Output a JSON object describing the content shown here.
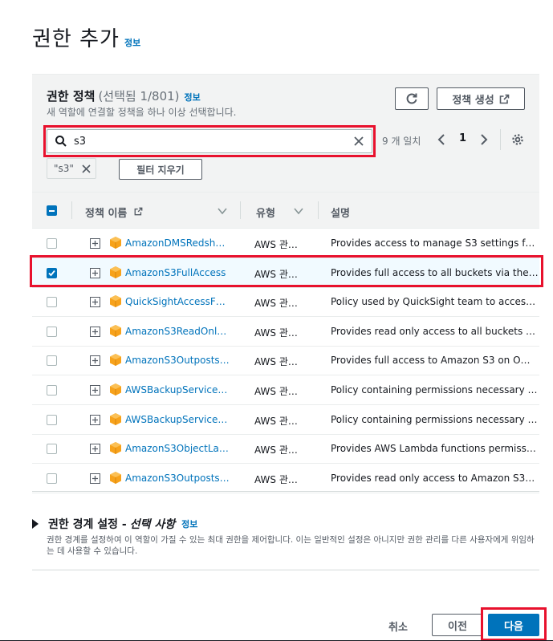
{
  "page": {
    "title": "권한 추가",
    "info_link": "정보"
  },
  "policies": {
    "title": "권한 정책",
    "count": "(선택됨 1/801)",
    "info_link": "정보",
    "description": "새 역할에 연결할 정책을 하나 이상 선택합니다.",
    "create_label": "정책 생성",
    "search_value": "s3",
    "match_text": "9 개 일치",
    "page": "1",
    "filter_token": "\"s3\"",
    "clear_filters_label": "필터 지우기",
    "columns": {
      "name": "정책 이름",
      "type": "유형",
      "description": "설명"
    },
    "rows": [
      {
        "name": "AmazonDMSRedsh…",
        "type": "AWS 관…",
        "description": "Provides access to manage S3 settings f…",
        "checked": false
      },
      {
        "name": "AmazonS3FullAccess",
        "type": "AWS 관…",
        "description": "Provides full access to all buckets via the…",
        "checked": true
      },
      {
        "name": "QuickSightAccessF…",
        "type": "AWS 관…",
        "description": "Policy used by QuickSight team to acces…",
        "checked": false
      },
      {
        "name": "AmazonS3ReadOnl…",
        "type": "AWS 관…",
        "description": "Provides read only access to all buckets …",
        "checked": false
      },
      {
        "name": "AmazonS3Outposts…",
        "type": "AWS 관…",
        "description": "Provides full access to Amazon S3 on O…",
        "checked": false
      },
      {
        "name": "AWSBackupService…",
        "type": "AWS 관…",
        "description": "Policy containing permissions necessary …",
        "checked": false
      },
      {
        "name": "AWSBackupService…",
        "type": "AWS 관…",
        "description": "Policy containing permissions necessary …",
        "checked": false
      },
      {
        "name": "AmazonS3ObjectLa…",
        "type": "AWS 관…",
        "description": "Provides AWS Lambda functions permiss…",
        "checked": false
      },
      {
        "name": "AmazonS3Outposts…",
        "type": "AWS 관…",
        "description": "Provides read only access to Amazon S3…",
        "checked": false
      }
    ]
  },
  "boundary": {
    "title": "권한 경계 설정 -",
    "optional": "선택 사항",
    "info_link": "정보",
    "description": "권한 경계를 설정하여 이 역할이 가질 수 있는 최대 권한을 제어합니다. 이는 일반적인 설정은 아니지만 권한 관리를 다른 사용자에게 위임하는 데 사용할 수 있습니다."
  },
  "footer": {
    "cancel_label": "취소",
    "previous_label": "이전",
    "next_label": "다음"
  },
  "colors": {
    "link": "#0073bb",
    "primary": "#0073bb",
    "highlight": "#e8112d",
    "header_bg": "#f2f3f3"
  },
  "icons": [
    "refresh-icon",
    "external-link-icon",
    "search-icon",
    "clear-icon",
    "chevron-left-icon",
    "chevron-right-icon",
    "settings-icon",
    "close-icon",
    "sort-caret-icon",
    "expand-icon",
    "policy-cube-icon",
    "caret-right-icon"
  ]
}
